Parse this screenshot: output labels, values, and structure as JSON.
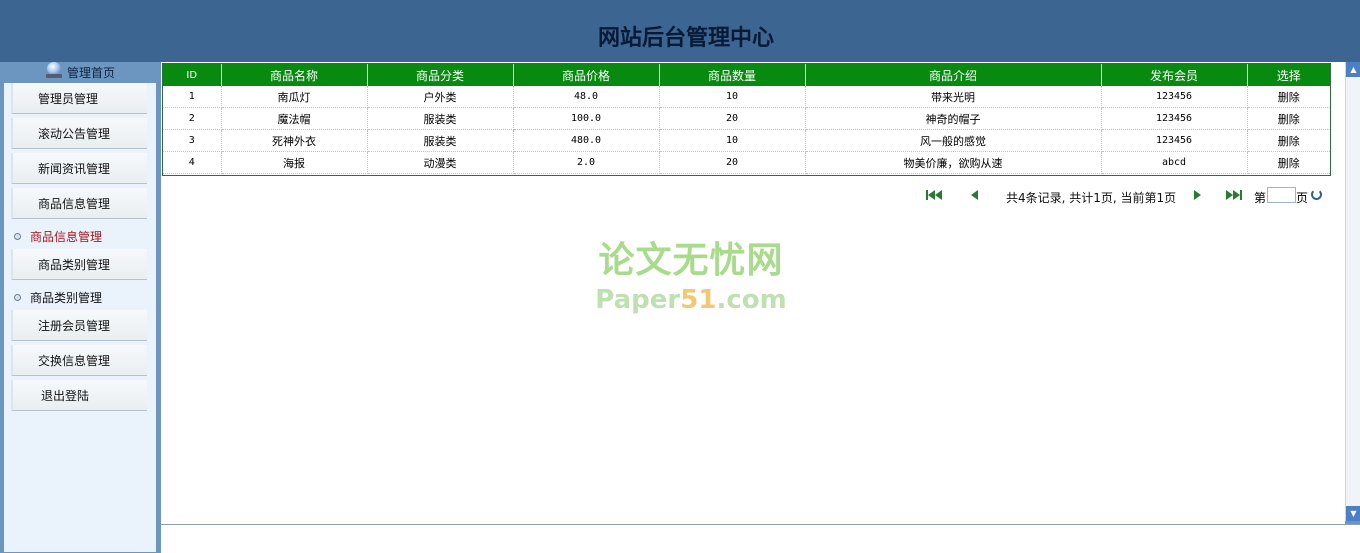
{
  "header": {
    "title": "网站后台管理中心"
  },
  "sidebar": {
    "home_label": "管理首页",
    "items": [
      {
        "label": "管理员管理",
        "type": "main"
      },
      {
        "label": "滚动公告管理",
        "type": "main"
      },
      {
        "label": "新闻资讯管理",
        "type": "main"
      },
      {
        "label": "商品信息管理",
        "type": "main"
      },
      {
        "label": "商品信息管理",
        "type": "sub",
        "active": true
      },
      {
        "label": "商品类别管理",
        "type": "main"
      },
      {
        "label": "商品类别管理",
        "type": "sub"
      },
      {
        "label": "注册会员管理",
        "type": "main"
      },
      {
        "label": "交换信息管理",
        "type": "main"
      },
      {
        "label": "退出登陆",
        "type": "main"
      }
    ]
  },
  "table": {
    "columns": [
      "ID",
      "商品名称",
      "商品分类",
      "商品价格",
      "商品数量",
      "商品介绍",
      "发布会员",
      "选择"
    ],
    "rows": [
      [
        "1",
        "南瓜灯",
        "户外类",
        "48.0",
        "10",
        "带来光明",
        "123456",
        "删除"
      ],
      [
        "2",
        "魔法帽",
        "服装类",
        "100.0",
        "20",
        "神奇的帽子",
        "123456",
        "删除"
      ],
      [
        "3",
        "死神外衣",
        "服装类",
        "480.0",
        "10",
        "风一般的感觉",
        "123456",
        "删除"
      ],
      [
        "4",
        "海报",
        "动漫类",
        "2.0",
        "20",
        "物美价廉，欲购从速",
        "abcd",
        "删除"
      ]
    ]
  },
  "pager": {
    "info": "共4条记录, 共计1页, 当前第1页",
    "page_prefix": "第",
    "page_suffix": "页",
    "page_value": ""
  },
  "watermark": {
    "line1": "论文无忧网",
    "line2_a": "Paper",
    "line2_b": "51",
    "line2_c": ".com"
  },
  "colors": {
    "header_bg": "#3d6591",
    "table_header_bg": "#078a0f",
    "active_menu_text": "#a8151c",
    "sidebar_bg": "#eaf2fb"
  }
}
